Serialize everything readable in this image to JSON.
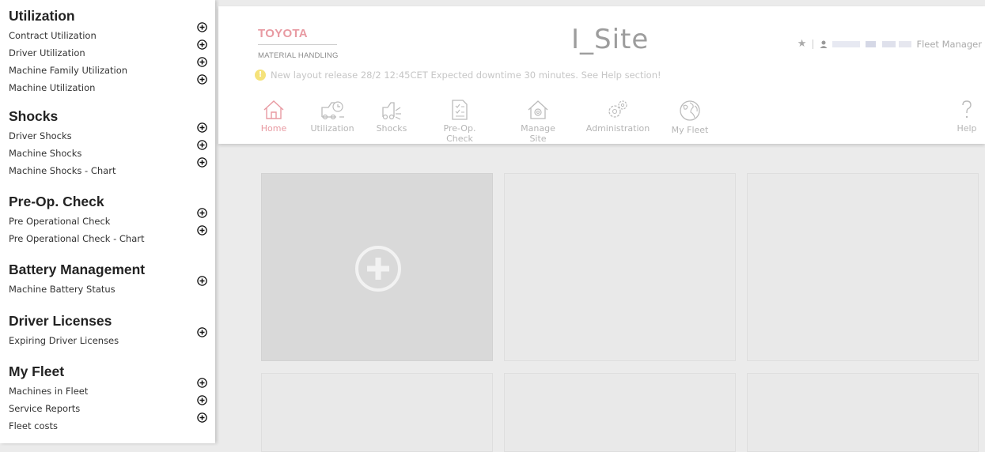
{
  "sidebar": {
    "sections": [
      {
        "title": "Utilization",
        "items": [
          "Contract Utilization",
          "Driver Utilization",
          "Machine Family Utilization",
          "Machine Utilization"
        ]
      },
      {
        "title": "Shocks",
        "items": [
          "Driver Shocks",
          "Machine Shocks",
          "Machine Shocks - Chart"
        ]
      },
      {
        "title": "Pre-Op. Check",
        "items": [
          "Pre Operational Check",
          "Pre Operational Check - Chart"
        ]
      },
      {
        "title": "Battery Management",
        "items": [
          "Machine Battery Status"
        ]
      },
      {
        "title": "Driver Licenses",
        "items": [
          "Expiring Driver Licenses"
        ]
      },
      {
        "title": "My Fleet",
        "items": [
          "Machines in Fleet",
          "Service Reports",
          "Fleet costs"
        ]
      }
    ]
  },
  "header": {
    "brand": "TOYOTA",
    "brand_sub": "MATERIAL HANDLING",
    "site_title": "I_Site",
    "user_role": "Fleet Manager",
    "notice": "New layout release 28/2 12:45CET Expected downtime 30 minutes. See Help section!"
  },
  "nav": {
    "items": [
      {
        "label": "Home",
        "icon": "home-icon",
        "active": true
      },
      {
        "label": "Utilization",
        "icon": "forklift-clock-icon"
      },
      {
        "label": "Shocks",
        "icon": "forklift-impact-icon"
      },
      {
        "label": "Pre-Op. Check",
        "icon": "checklist-icon"
      },
      {
        "label": "Manage Site",
        "icon": "house-gear-icon"
      },
      {
        "label": "Administration",
        "icon": "gears-icon"
      },
      {
        "label": "My Fleet",
        "icon": "globe-icon"
      }
    ],
    "help_label": "Help",
    "help_icon": "question-icon"
  },
  "colors": {
    "accent": "#e89aa2",
    "tile": "#e9e9e9",
    "tile_add": "#d9d9d9",
    "background": "#ebebeb"
  }
}
